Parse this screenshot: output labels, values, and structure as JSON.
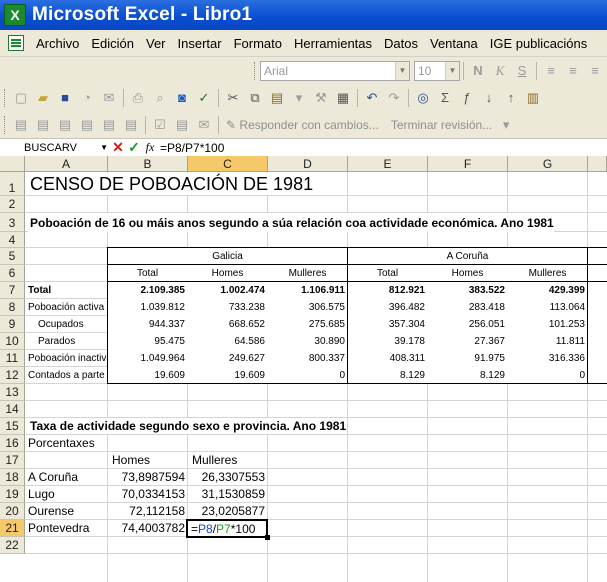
{
  "window": {
    "title": "Microsoft Excel - Libro1"
  },
  "menu": [
    "Archivo",
    "Edición",
    "Ver",
    "Insertar",
    "Formato",
    "Herramientas",
    "Datos",
    "Ventana",
    "IGE publicacións"
  ],
  "format_toolbar": {
    "font": "Arial",
    "size": "10"
  },
  "review_toolbar": {
    "reply": "Responder con cambios...",
    "end_review": "Terminar revisión..."
  },
  "formula_bar": {
    "name_box": "BUSCARV",
    "formula": "=P8/P7*100"
  },
  "columns": [
    "A",
    "B",
    "C",
    "D",
    "E",
    "F",
    "G"
  ],
  "rows": [
    "1",
    "2",
    "3",
    "4",
    "5",
    "6",
    "7",
    "8",
    "9",
    "10",
    "11",
    "12",
    "13",
    "14",
    "15",
    "16",
    "17",
    "18",
    "19",
    "20",
    "21",
    "22"
  ],
  "sheet": {
    "title": "CENSO DE POBOACIÓN DE 1981",
    "subtitle": "Poboación de 16 ou máis anos segundo a súa relación coa actividade económica. Ano 1981",
    "group_galicia": "Galicia",
    "group_coruna": "A Coruña",
    "col_total": "Total",
    "col_homes": "Homes",
    "col_mulleres": "Mulleres",
    "table": [
      {
        "label": "Total",
        "bold": true,
        "values": [
          "2.109.385",
          "1.002.474",
          "1.106.911",
          "812.921",
          "383.522",
          "429.399"
        ]
      },
      {
        "label": "Poboación activa",
        "bold": false,
        "values": [
          "1.039.812",
          "733.238",
          "306.575",
          "396.482",
          "283.418",
          "113.064"
        ]
      },
      {
        "label": "Ocupados",
        "bold": false,
        "indent": true,
        "values": [
          "944.337",
          "668.652",
          "275.685",
          "357.304",
          "256.051",
          "101.253"
        ]
      },
      {
        "label": "Parados",
        "bold": false,
        "indent": true,
        "values": [
          "95.475",
          "64.586",
          "30.890",
          "39.178",
          "27.367",
          "11.811"
        ]
      },
      {
        "label": "Poboación inactiva",
        "bold": false,
        "values": [
          "1.049.964",
          "249.627",
          "800.337",
          "408.311",
          "91.975",
          "316.336"
        ]
      },
      {
        "label": "Contados a parte",
        "bold": false,
        "values": [
          "19.609",
          "19.609",
          "0",
          "8.129",
          "8.129",
          "0"
        ]
      }
    ],
    "rate_title": "Taxa de actividade segundo sexo e provincia. Ano 1981",
    "rate_unit": "Porcentaxes",
    "rate_head_homes": "Homes",
    "rate_head_mulleres": "Mulleres",
    "rates": [
      {
        "province": "A Coruña",
        "homes": "73,8987594",
        "mulleres": "26,3307553"
      },
      {
        "province": "Lugo",
        "homes": "70,0334153",
        "mulleres": "31,1530859"
      },
      {
        "province": "Ourense",
        "homes": "72,112158",
        "mulleres": "23,0205877"
      },
      {
        "province": "Pontevedra",
        "homes": "74,4003782",
        "mulleres": ""
      }
    ],
    "edit_formula": {
      "eq": "=",
      "ref1": "P8",
      "slash": "/",
      "ref2": "P7",
      "tail": "*100"
    }
  }
}
